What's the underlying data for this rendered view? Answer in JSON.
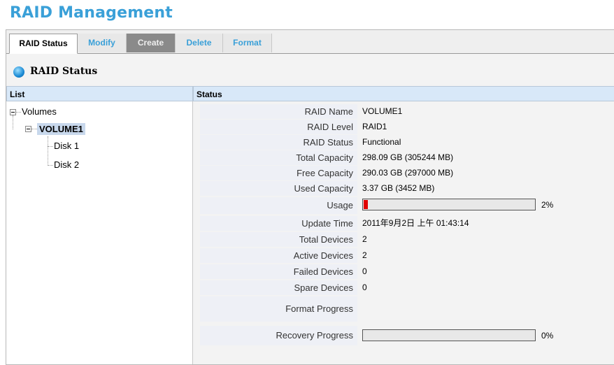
{
  "page": {
    "title": "RAID Management"
  },
  "tabs": [
    {
      "label": "RAID Status",
      "state": "active"
    },
    {
      "label": "Modify",
      "state": "light"
    },
    {
      "label": "Create",
      "state": "dark"
    },
    {
      "label": "Delete",
      "state": "light"
    },
    {
      "label": "Format",
      "state": "light"
    }
  ],
  "section": {
    "title": "RAID Status",
    "icon": "globe-icon"
  },
  "columns": {
    "list": "List",
    "status": "Status"
  },
  "tree": {
    "root": "Volumes",
    "volume": "VOLUME1",
    "disks": [
      "Disk 1",
      "Disk 2"
    ]
  },
  "status": {
    "raid_name": {
      "label": "RAID Name",
      "value": "VOLUME1"
    },
    "raid_level": {
      "label": "RAID Level",
      "value": "RAID1"
    },
    "raid_status": {
      "label": "RAID Status",
      "value": "Functional"
    },
    "total_capacity": {
      "label": "Total Capacity",
      "value": "298.09 GB (305244 MB)"
    },
    "free_capacity": {
      "label": "Free Capacity",
      "value": "290.03 GB (297000 MB)"
    },
    "used_capacity": {
      "label": "Used Capacity",
      "value": "3.37 GB (3452 MB)"
    },
    "usage": {
      "label": "Usage",
      "percent_text": "2%",
      "fraction": 0.02
    },
    "update_time": {
      "label": "Update Time",
      "value": "2011年9月2日 上午 01:43:14"
    },
    "total_devices": {
      "label": "Total Devices",
      "value": "2"
    },
    "active_devices": {
      "label": "Active Devices",
      "value": "2"
    },
    "failed_devices": {
      "label": "Failed Devices",
      "value": "0"
    },
    "spare_devices": {
      "label": "Spare Devices",
      "value": "0"
    },
    "format_progress": {
      "label": "Format Progress",
      "value": ""
    },
    "recovery_progress": {
      "label": "Recovery Progress",
      "percent_text": "0%",
      "fraction": 0
    }
  },
  "colors": {
    "accent": "#3aa0d8",
    "usage_bar": "#e00000",
    "header_bg": "#d8e8f8"
  }
}
